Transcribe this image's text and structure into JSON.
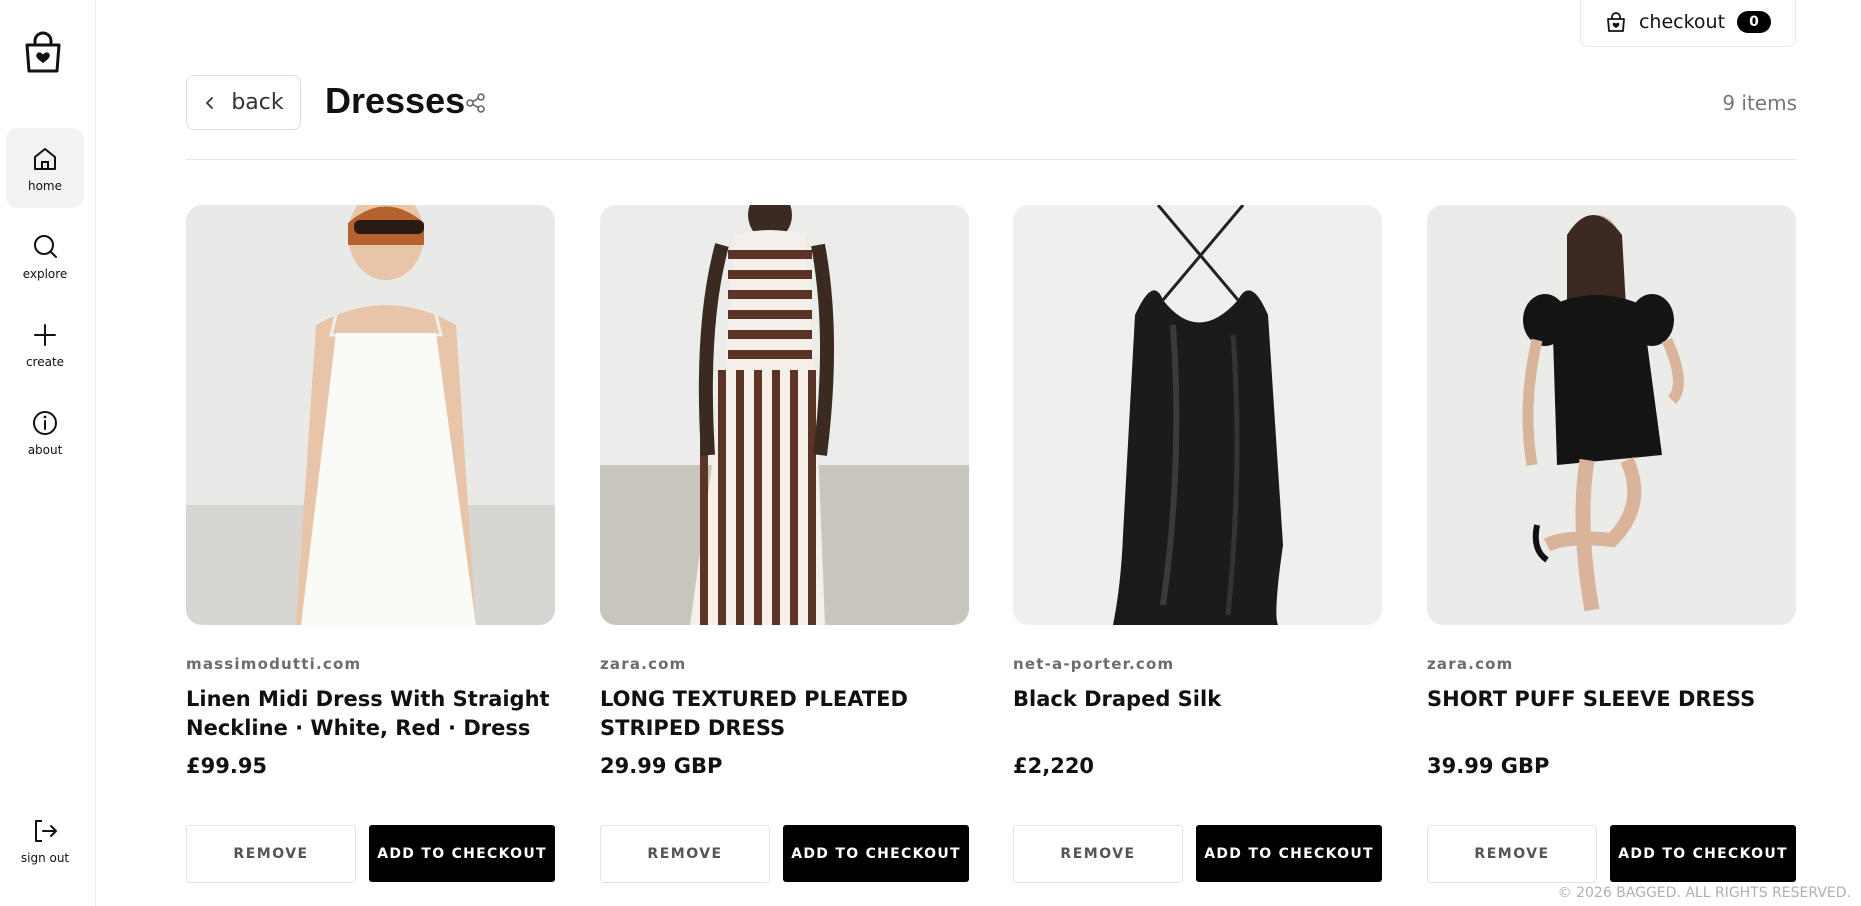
{
  "sidebar": {
    "items": [
      {
        "label": "home",
        "icon": "home-icon",
        "active": true
      },
      {
        "label": "explore",
        "icon": "search-icon"
      },
      {
        "label": "create",
        "icon": "plus-icon"
      },
      {
        "label": "about",
        "icon": "info-icon"
      }
    ],
    "signout_label": "sign out"
  },
  "header": {
    "checkout_label": "checkout",
    "checkout_count": "0",
    "back_label": "back",
    "title": "Dresses",
    "item_count": "9 items"
  },
  "products": [
    {
      "source": "massimodutti.com",
      "title": "Linen Midi Dress With Straight Neckline · White, Red · Dress",
      "price": "£99.95",
      "remove_label": "REMOVE",
      "add_label": "ADD TO CHECKOUT"
    },
    {
      "source": "zara.com",
      "title": "LONG TEXTURED PLEATED STRIPED DRESS",
      "price": "29.99 GBP",
      "remove_label": "REMOVE",
      "add_label": "ADD TO CHECKOUT"
    },
    {
      "source": "net-a-porter.com",
      "title": "Black Draped Silk",
      "price": "£2,220",
      "remove_label": "REMOVE",
      "add_label": "ADD TO CHECKOUT"
    },
    {
      "source": "zara.com",
      "title": "SHORT PUFF SLEEVE DRESS",
      "price": "39.99 GBP",
      "remove_label": "REMOVE",
      "add_label": "ADD TO CHECKOUT"
    }
  ],
  "footer": {
    "copyright": "© 2026 BAGGED. ALL RIGHTS RESERVED."
  },
  "colors": {
    "accent": "#000000",
    "muted": "#6d6d6d"
  }
}
